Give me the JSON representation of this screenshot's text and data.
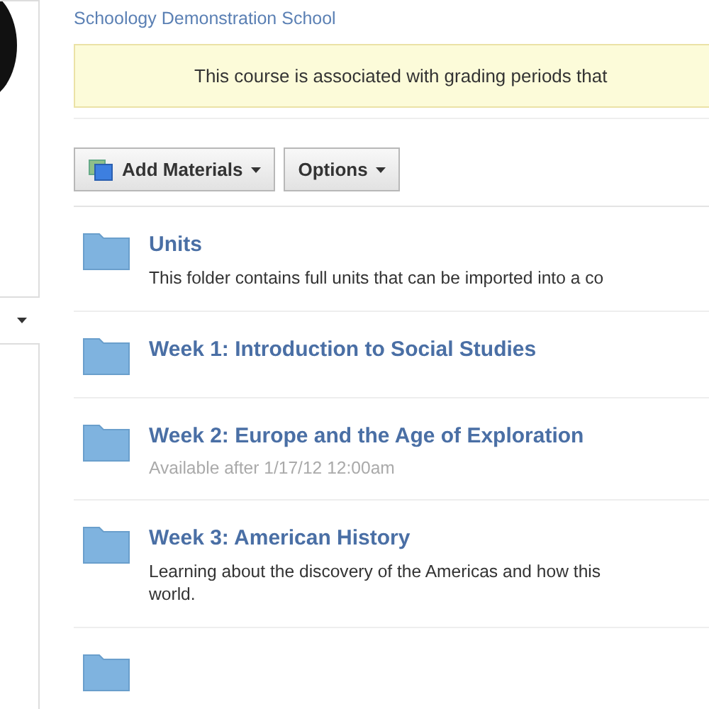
{
  "school_link": "Schoology Demonstration School",
  "notice": "This course is associated with grading periods that",
  "toolbar": [
    {
      "label": "Add Materials",
      "kind": "add"
    },
    {
      "label": "Options",
      "kind": "plain"
    }
  ],
  "folders": [
    {
      "kind": "folder",
      "title": "Units",
      "description": "This folder contains full units that can be imported into a co"
    },
    {
      "kind": "folder",
      "title": "Week 1: Introduction to Social Studies"
    },
    {
      "kind": "folder",
      "title": "Week 2: Europe and the Age of Exploration",
      "availability": "Available after 1/17/12 12:00am"
    },
    {
      "kind": "folder",
      "title": "Week 3: American History",
      "description": "Learning about the discovery of the Americas and how this",
      "description_2": "world."
    },
    {
      "kind": "cut"
    }
  ]
}
